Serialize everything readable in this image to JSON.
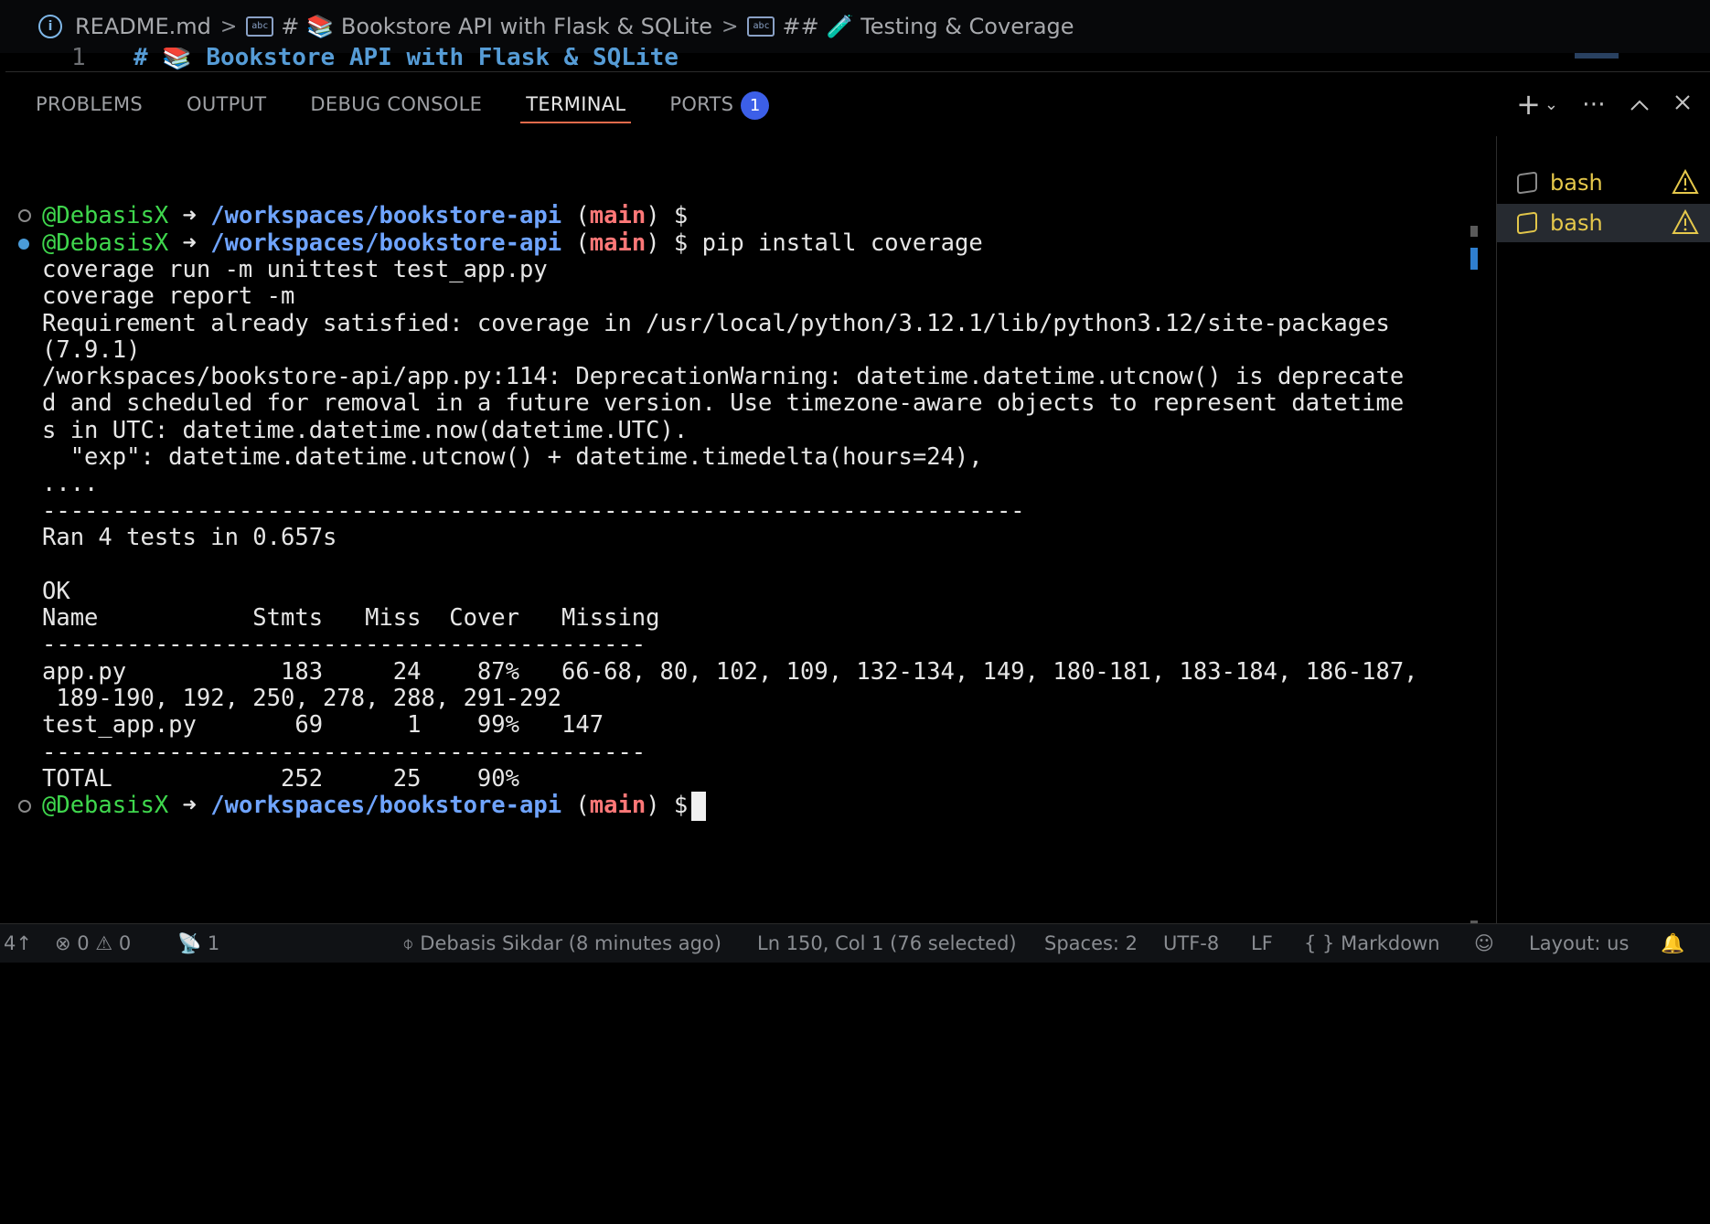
{
  "breadcrumb": {
    "file": "README.md",
    "section1": "📚 Bookstore API with Flask & SQLite",
    "section2": "🧪 Testing & Coverage",
    "hash1": "#",
    "hash2": "##"
  },
  "editor": {
    "line_number": "1",
    "line_text": "# 📚 Bookstore API with Flask & SQLite"
  },
  "panel": {
    "tabs": [
      {
        "label": "PROBLEMS"
      },
      {
        "label": "OUTPUT"
      },
      {
        "label": "DEBUG CONSOLE"
      },
      {
        "label": "TERMINAL"
      },
      {
        "label": "PORTS"
      }
    ],
    "active_tab": "TERMINAL",
    "ports_badge": "1"
  },
  "terminal": {
    "user": "@DebasisX",
    "arrow": "➜",
    "path": "/workspaces/bookstore-api",
    "branch": "main",
    "prompt": "$",
    "command": "pip install coverage",
    "output_lines": [
      "coverage run -m unittest test_app.py",
      "coverage report -m",
      "Requirement already satisfied: coverage in /usr/local/python/3.12.1/lib/python3.12/site-packages",
      "(7.9.1)",
      "/workspaces/bookstore-api/app.py:114: DeprecationWarning: datetime.datetime.utcnow() is deprecate",
      "d and scheduled for removal in a future version. Use timezone-aware objects to represent datetime",
      "s in UTC: datetime.datetime.now(datetime.UTC).",
      "  \"exp\": datetime.datetime.utcnow() + datetime.timedelta(hours=24),",
      "....",
      "----------------------------------------------------------------------",
      "Ran 4 tests in 0.657s",
      "",
      "OK",
      "Name           Stmts   Miss  Cover   Missing",
      "-------------------------------------------",
      "app.py           183     24    87%   66-68, 80, 102, 109, 132-134, 149, 180-181, 183-184, 186-187,",
      " 189-190, 192, 250, 278, 288, 291-292",
      "test_app.py       69      1    99%   147",
      "-------------------------------------------",
      "TOTAL            252     25    90%"
    ]
  },
  "terminal_list": [
    {
      "name": "bash"
    },
    {
      "name": "bash"
    }
  ],
  "statusbar": {
    "remote": "4↑",
    "errors": "0",
    "warnings": "0",
    "ports": "1",
    "blame": "Debasis Sikdar (8 minutes ago)",
    "cursor": "Ln 150, Col 1 (76 selected)",
    "spaces": "Spaces: 2",
    "encoding": "UTF-8",
    "eol": "LF",
    "language": "Markdown",
    "layout": "Layout: us"
  },
  "colors": {
    "accent_tab": "#e36b4b",
    "badge": "#3c5fe8",
    "user": "#3fd74d",
    "path": "#6fa4ff",
    "branch": "#ff7878",
    "terminal_name": "#e5c84b"
  }
}
